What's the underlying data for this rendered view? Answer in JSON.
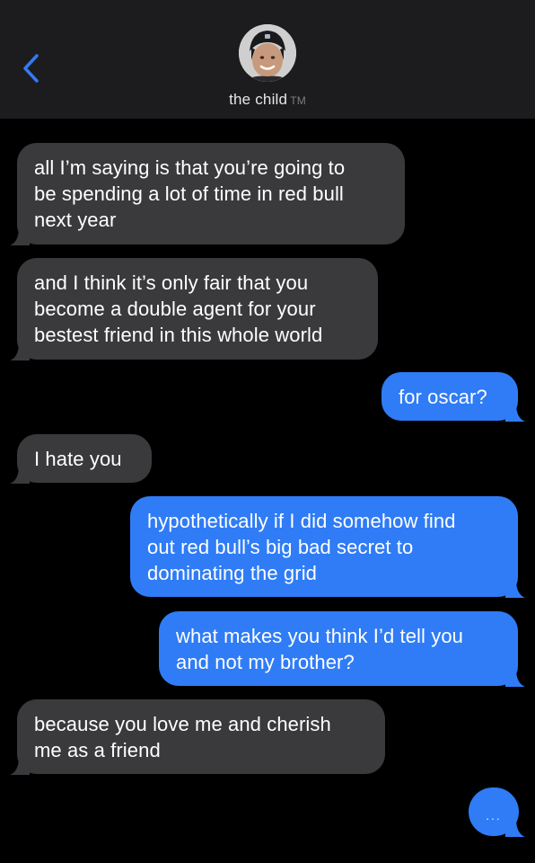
{
  "header": {
    "contact_name": "the child",
    "contact_tag": "TM",
    "back_icon": "chevron-left-icon",
    "accent_color": "#3478f6"
  },
  "messages": [
    {
      "direction": "incoming",
      "lines": [
        "all I’m saying is that you’re going to",
        "be spending a lot of time in red bull",
        "next year"
      ]
    },
    {
      "direction": "incoming",
      "lines": [
        "and I think it’s only fair that you",
        "become a double agent for your",
        "bestest friend in this whole world"
      ]
    },
    {
      "direction": "outgoing",
      "lines": [
        "for oscar?"
      ]
    },
    {
      "direction": "incoming",
      "lines": [
        "I hate you"
      ]
    },
    {
      "direction": "outgoing",
      "lines": [
        "hypothetically if I did somehow find",
        "out red bull’s big bad secret to",
        "dominating the grid"
      ]
    },
    {
      "direction": "outgoing",
      "lines": [
        "what makes you think I’d tell you",
        "and not my brother?"
      ]
    },
    {
      "direction": "incoming",
      "lines": [
        "because you love me and cherish",
        "me as a friend"
      ]
    }
  ],
  "typing_indicator": "...",
  "colors": {
    "incoming_bubble": "#3a3a3c",
    "outgoing_bubble": "#2f7cf6",
    "background": "#000000",
    "header": "#1c1c1e"
  }
}
